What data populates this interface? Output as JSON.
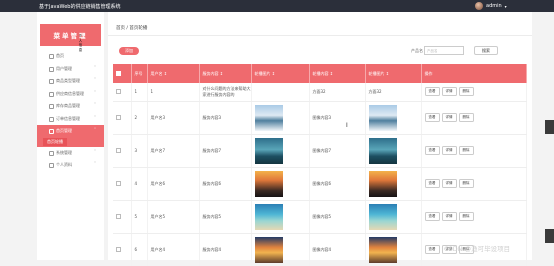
{
  "app": {
    "title": "基于JavaWeb的供应链销售管理系统",
    "user": "admin",
    "user_caret": "▾"
  },
  "sidebar": {
    "logo": "菜单管理",
    "logo_side": "个人信息",
    "items": [
      {
        "label": "首页",
        "icon": "home-icon",
        "arrow": ""
      },
      {
        "label": "用户管理",
        "icon": "user-icon",
        "arrow": "˅"
      },
      {
        "label": "商品类型管理",
        "icon": "tag-icon",
        "arrow": "˅"
      },
      {
        "label": "供应商信息管理",
        "icon": "list-icon",
        "arrow": "˅"
      },
      {
        "label": "库存商品管理",
        "icon": "box-icon",
        "arrow": "˅"
      },
      {
        "label": "订单信息管理",
        "icon": "order-icon",
        "arrow": "˅"
      },
      {
        "label": "首页管理",
        "icon": "grid-icon",
        "arrow": "˄",
        "active": true
      },
      {
        "label": "系统管理",
        "icon": "gear-icon",
        "arrow": "˅"
      },
      {
        "label": "个人资料",
        "icon": "profile-icon",
        "arrow": "˅"
      }
    ],
    "sub_item": "首页轮播"
  },
  "main": {
    "breadcrumb": "首页 / 首页轮播",
    "add_button": "添加",
    "search_label": "产品名",
    "search_placeholder": "产品名",
    "search_button": "搜索",
    "columns": [
      "",
      "序号",
      "用户名 ↕",
      "服务内容 ↕",
      "轮播图片 ↕",
      "轮播内容 ↕",
      "轮播图片 ↕",
      "操作"
    ],
    "ops": [
      "查看",
      "详情",
      "删除"
    ],
    "rows": [
      {
        "idx": "1",
        "name": "1",
        "content": "对什么问题的方法来帮助大家进行服务内容的",
        "img1": "",
        "desc": "方面32",
        "img2": "方面32"
      },
      {
        "idx": "2",
        "name": "用户名3",
        "content": "服务内容3",
        "img1": "snow",
        "desc": "图像内容3",
        "img2": "snow"
      },
      {
        "idx": "3",
        "name": "用户名7",
        "content": "服务内容7",
        "img1": "lake",
        "desc": "图像内容7",
        "img2": "lake"
      },
      {
        "idx": "4",
        "name": "用户名6",
        "content": "服务内容6",
        "img1": "sunset",
        "desc": "图像内容6",
        "img2": "sunset"
      },
      {
        "idx": "5",
        "name": "用户名5",
        "content": "服务内容5",
        "img1": "beach",
        "desc": "图像内容5",
        "img2": "beach"
      },
      {
        "idx": "6",
        "name": "用户名4",
        "content": "服务内容4",
        "img1": "dusk",
        "desc": "图像内容4",
        "img2": "dusk"
      }
    ]
  },
  "watermark": "CSDN @渔可毕设项目",
  "colors": {
    "accent": "#ef6a6e",
    "topbar": "#2b2f3a"
  }
}
